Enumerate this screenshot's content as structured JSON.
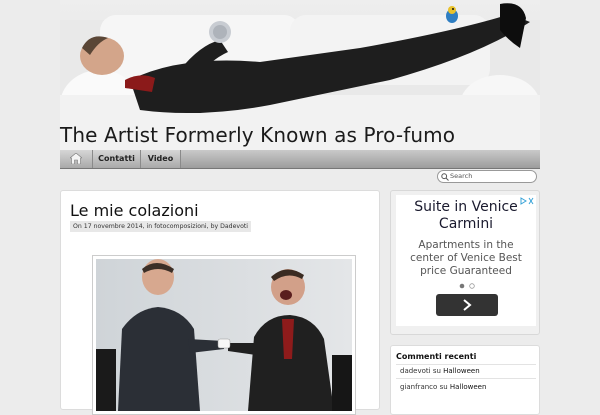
{
  "header": {
    "site_title": "The Artist Formerly Known as Pro-fumo"
  },
  "nav": {
    "home_icon": "home-icon",
    "items": [
      {
        "label": "Contatti"
      },
      {
        "label": "Video"
      }
    ]
  },
  "search": {
    "placeholder": "Search",
    "icon": "search-icon"
  },
  "post": {
    "title": "Le mie colazioni",
    "meta": "On 17 novembre 2014, in fotocomposizioni, by Dadevoti"
  },
  "ad": {
    "title": "Suite in Venice Carmini",
    "body": "Apartments in the center of Venice Best price Guaranteed",
    "button_icon": "chevron-right-icon",
    "choices_icon": "adchoices-icon"
  },
  "sidebar": {
    "comments_title": "Commenti recenti",
    "comments": [
      {
        "author": "dadevoti",
        "on": "su",
        "post": "Halloween"
      },
      {
        "author": "gianfranco",
        "on": "su",
        "post": "Halloween"
      }
    ]
  },
  "colors": {
    "page_bg": "#ececec",
    "nav_gradient_top": "#c9c9c9",
    "nav_gradient_bottom": "#9d9d9d",
    "ad_link": "#39a3d8",
    "ad_button": "#333333"
  }
}
